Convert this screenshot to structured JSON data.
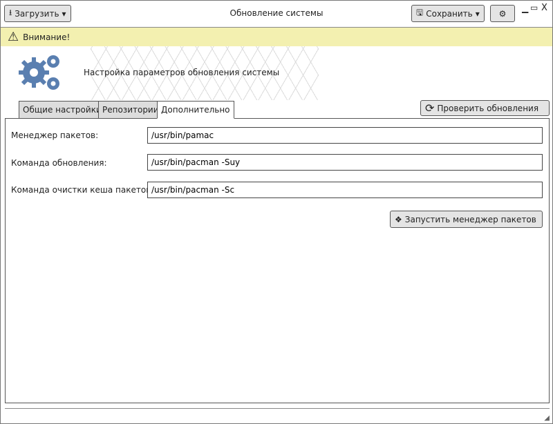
{
  "window": {
    "title": "Обновление системы",
    "load_label": "Загрузить",
    "save_label": "Сохранить"
  },
  "warning": {
    "text": "Внимание!"
  },
  "header": {
    "title": "Настройка параметров обновления системы"
  },
  "tabs": [
    {
      "label": "Общие настройки"
    },
    {
      "label": "Репозитории"
    },
    {
      "label": "Дополнительно"
    }
  ],
  "check_updates_label": "Проверить обновления",
  "fields": [
    {
      "label": "Менеджер пакетов:",
      "value": "/usr/bin/pamac"
    },
    {
      "label": "Команда обновления:",
      "value": "/usr/bin/pacman -Suy"
    },
    {
      "label": "Команда очистки кеша пакетов:",
      "value": "/usr/bin/pacman -Sc"
    }
  ],
  "run_manager_label": "Запустить менеджер пакетов",
  "colors": {
    "warning_bg": "#f3f0b0",
    "gear": "#5a7fb0"
  }
}
